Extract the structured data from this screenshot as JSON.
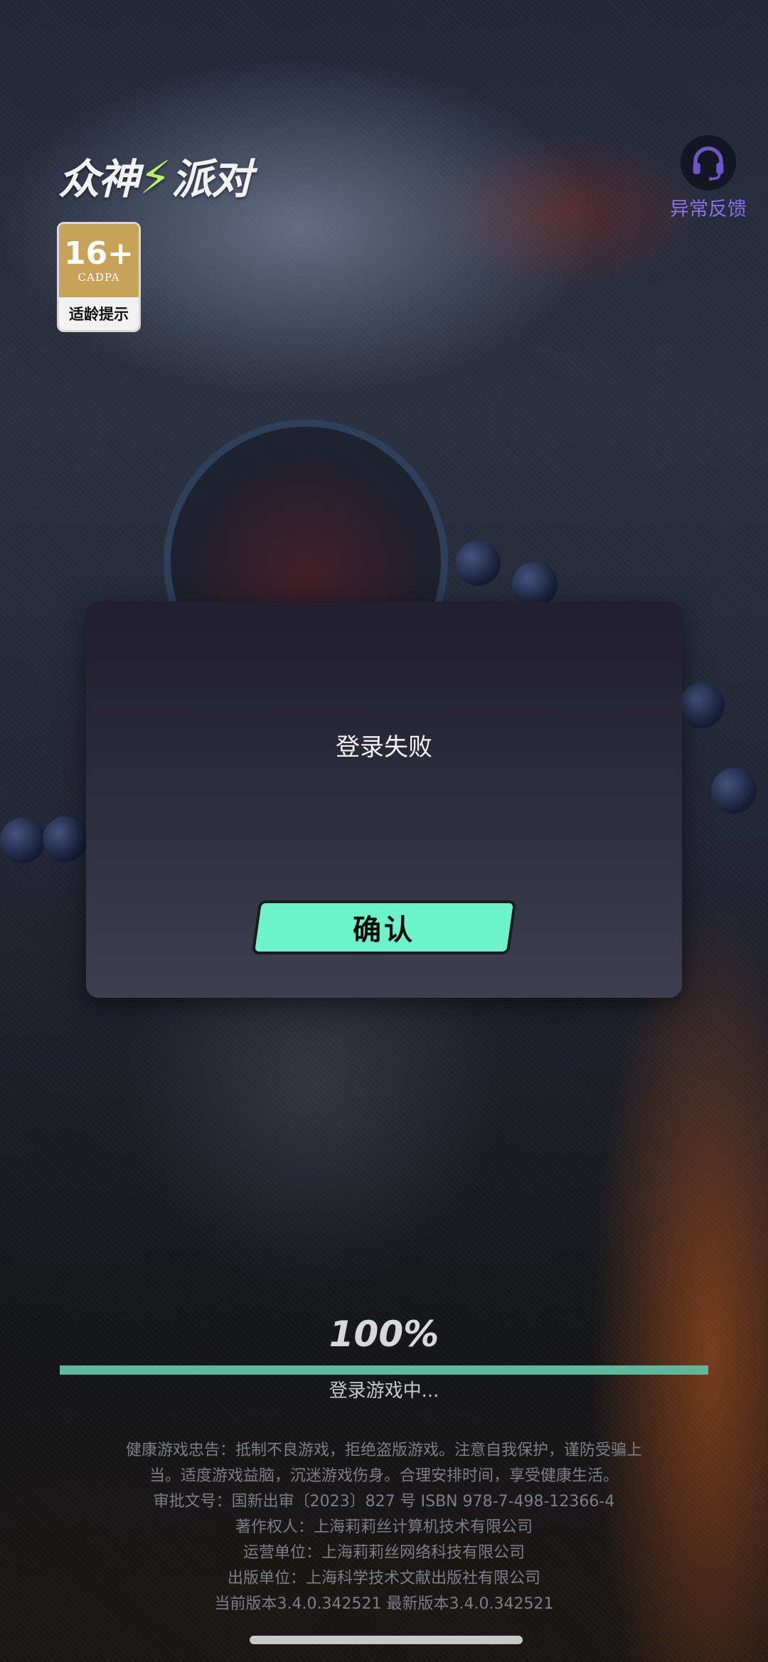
{
  "game": {
    "logo_left": "众神",
    "logo_bolt": "⚡",
    "logo_right": "派对"
  },
  "age_rating": {
    "age": "16+",
    "org": "CADPA",
    "label": "适龄提示"
  },
  "feedback": {
    "label": "异常反馈",
    "icon": "headset-icon"
  },
  "dialog": {
    "message": "登录失败",
    "confirm_label": "确认"
  },
  "loading": {
    "percent_text": "100%",
    "progress": 1.0,
    "status": "登录游戏中..."
  },
  "footer": {
    "line1": "健康游戏忠告：抵制不良游戏，拒绝盗版游戏。注意自我保护，谨防受骗上",
    "line2": "当。适度游戏益脑，沉迷游戏伤身。合理安排时间，享受健康生活。",
    "approval": "审批文号：国新出审〔2023〕827 号 ISBN  978-7-498-12366-4",
    "copyright": "著作权人：上海莉莉丝计算机技术有限公司",
    "operator": "运营单位：上海莉莉丝网络科技有限公司",
    "publisher": "出版单位：上海科学技术文献出版社有限公司",
    "version": "当前版本3.4.0.342521    最新版本3.4.0.342521"
  },
  "colors": {
    "accent": "#6ef2c9",
    "progress": "#5fb89c",
    "feedback": "#8a72e6"
  }
}
